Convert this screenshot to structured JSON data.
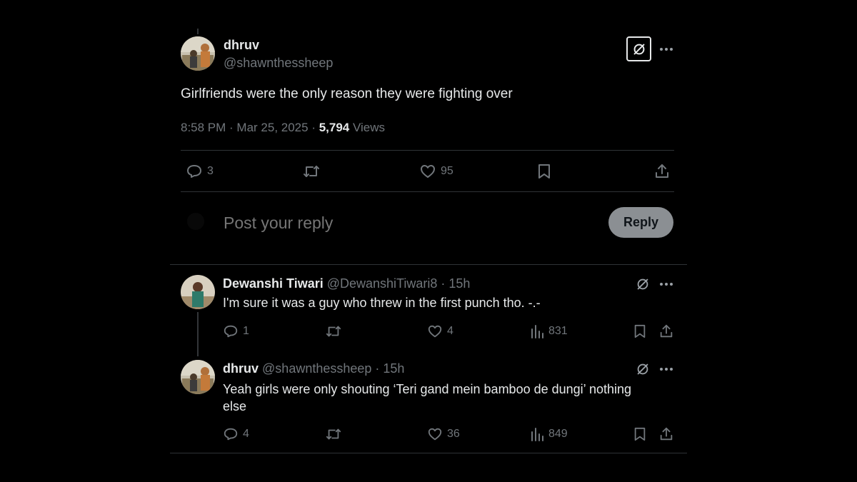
{
  "main_post": {
    "display_name": "dhruv",
    "handle": "@shawnthessheep",
    "text": "Girlfriends were the only reason they were fighting over",
    "time_date": "8:58 PM · Mar 25, 2025 · ",
    "views_count": "5,794",
    "views_label": "Views",
    "replies": "3",
    "likes": "95"
  },
  "composer": {
    "placeholder": "Post your reply",
    "button_label": "Reply"
  },
  "replies": [
    {
      "display_name": "Dewanshi Tiwari",
      "handle_time": "@DewanshiTiwari8 · 15h",
      "text": "I'm sure it was a guy who threw in the first punch tho. -.-",
      "replies": "1",
      "likes": "4",
      "views": "831"
    },
    {
      "display_name": "dhruv",
      "handle_time": "@shawnthessheep · 15h",
      "text_line1": "Yeah girls were only shouting ‘Teri gand mein bamboo de dungi’ nothing",
      "text_line2": "else",
      "replies": "4",
      "likes": "36",
      "views": "849"
    }
  ],
  "colors": {
    "background": "#000000",
    "text_primary": "#e7e9ea",
    "text_muted": "#71767b",
    "divider": "#2f3336",
    "reply_button_bg": "#8b8f93"
  }
}
